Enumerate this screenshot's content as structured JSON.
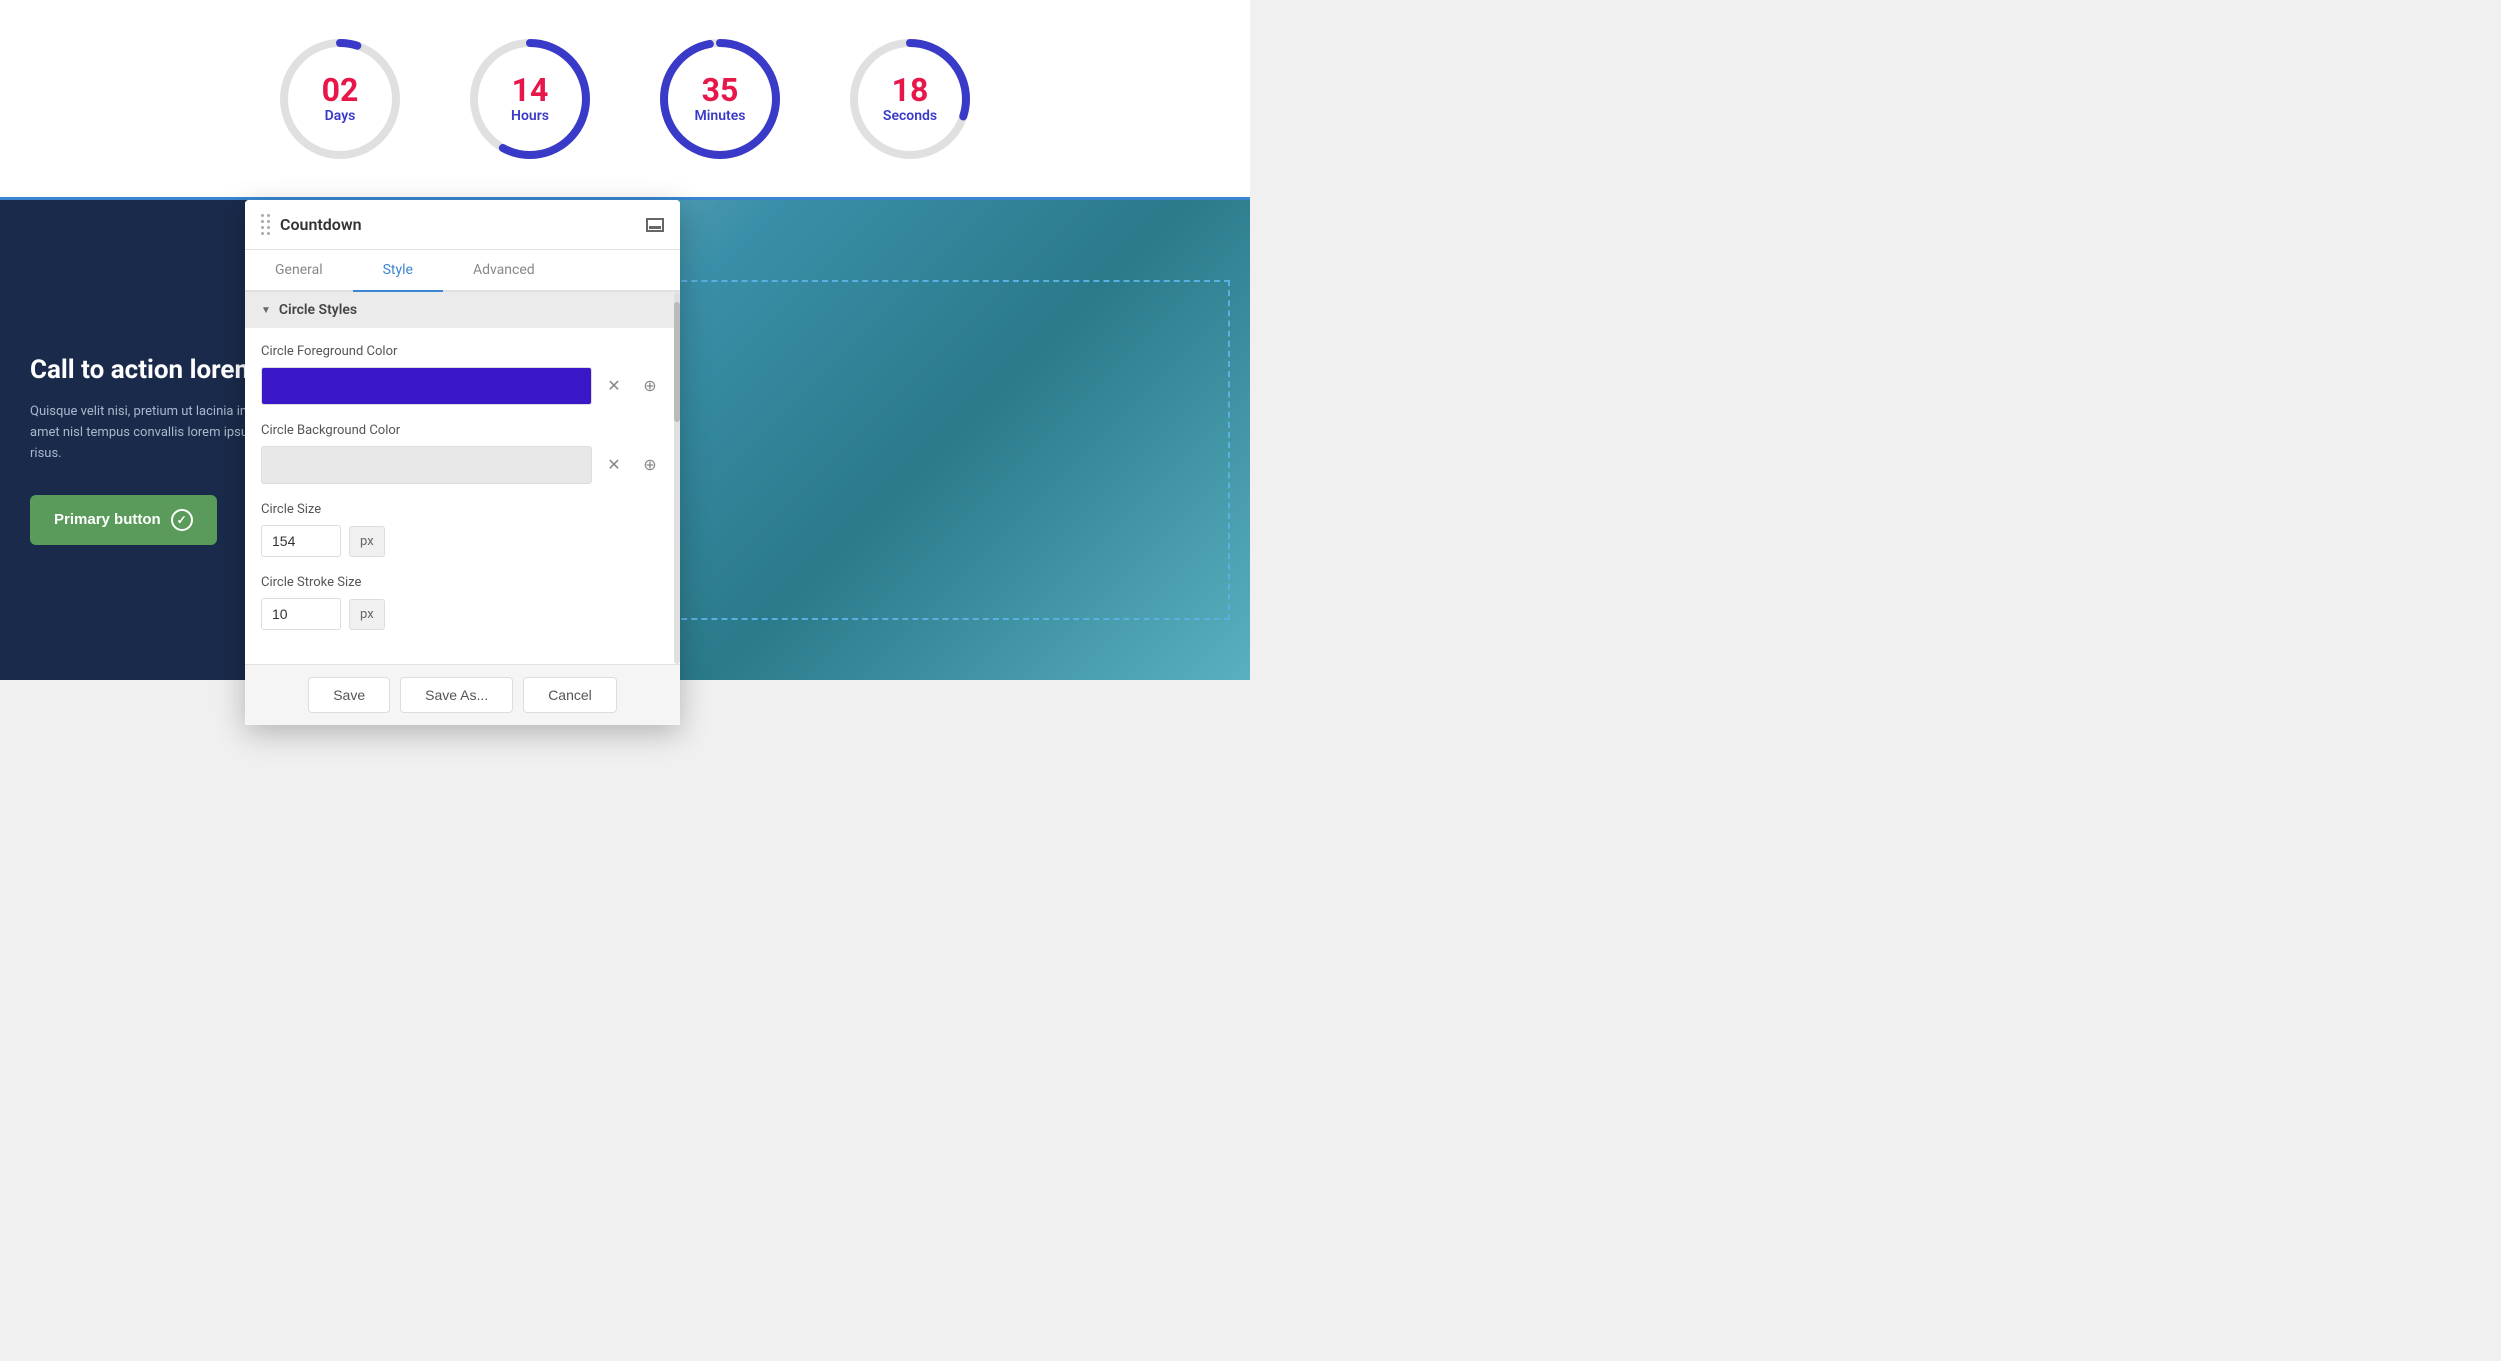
{
  "countdown": {
    "items": [
      {
        "id": "days",
        "number": "02",
        "label": "Days",
        "progress": 0.05,
        "color": "#3a3ac8"
      },
      {
        "id": "hours",
        "number": "14",
        "label": "Hours",
        "progress": 0.58,
        "color": "#3a3ac8"
      },
      {
        "id": "minutes",
        "number": "35",
        "label": "Minutes",
        "progress": 0.97,
        "color": "#3a3ac8"
      },
      {
        "id": "seconds",
        "number": "18",
        "label": "Seconds",
        "progress": 0.3,
        "color": "#3a3ac8"
      }
    ]
  },
  "cta": {
    "title": "Call to action lorem ispu",
    "description": "Quisque velit nisi, pretium ut lacinia in, elementum amet nisl tempus convallis lorem ipsum doror quis risus.",
    "button_label": "Primary button"
  },
  "panel": {
    "title": "Countdown",
    "tabs": [
      {
        "id": "general",
        "label": "General"
      },
      {
        "id": "style",
        "label": "Style"
      },
      {
        "id": "advanced",
        "label": "Advanced"
      }
    ],
    "active_tab": "style",
    "section": {
      "label": "Circle Styles"
    },
    "fields": {
      "fg_color_label": "Circle Foreground Color",
      "bg_color_label": "Circle Background Color",
      "size_label": "Circle Size",
      "size_value": "154",
      "size_unit": "px",
      "stroke_label": "Circle Stroke Size",
      "stroke_value": "10",
      "stroke_unit": "px"
    },
    "footer": {
      "save": "Save",
      "save_as": "Save As...",
      "cancel": "Cancel"
    }
  }
}
